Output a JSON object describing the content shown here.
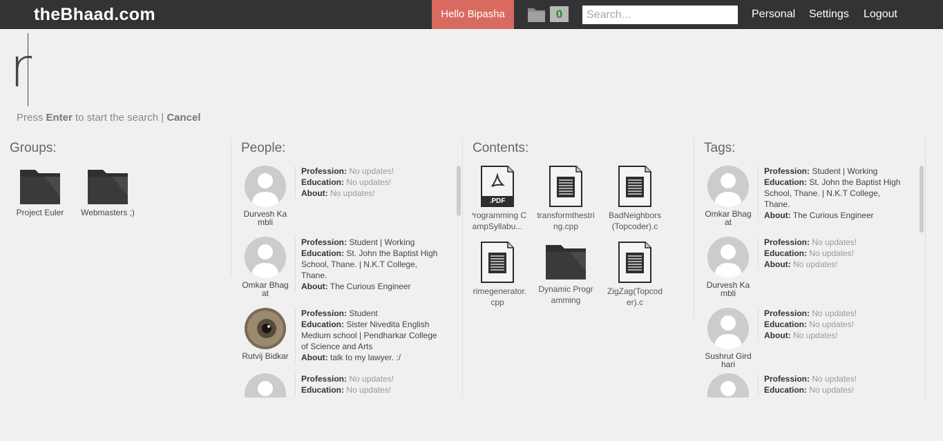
{
  "header": {
    "logo": "theBhaad.com",
    "greeting": "Hello Bipasha",
    "folder_count": "0",
    "search_placeholder": "Search...",
    "nav": [
      "Personal",
      "Settings",
      "Logout"
    ]
  },
  "search": {
    "query": "r",
    "hint_press": "Press ",
    "hint_enter": "Enter",
    "hint_rest": " to start the search | ",
    "hint_cancel": "Cancel"
  },
  "groups": {
    "title": "Groups:",
    "items": [
      "Project Euler",
      "Webmasters ;)"
    ]
  },
  "people": {
    "title": "People:",
    "items": [
      {
        "name": "Durvesh Kambli",
        "profession": "No updates!",
        "education": "No updates!",
        "about": "No updates!",
        "muted": true
      },
      {
        "name": "Omkar Bhagat",
        "profession": "Student | Working",
        "education": "St. John the Baptist High School, Thane. | N.K.T College, Thane.",
        "about": "The Curious Engineer",
        "muted": false
      },
      {
        "name": "Rutvij Bidkar",
        "profession": "Student",
        "education": "Sister Nivedita English Medium school | Pendharkar College of Science and Arts",
        "about": "talk to my lawyer. :/",
        "muted": false
      },
      {
        "name": "",
        "profession": "No updates!",
        "education": "No updates!",
        "about": "",
        "muted": true
      }
    ]
  },
  "contents": {
    "title": "Contents:",
    "items": [
      {
        "name": "Programming CampSyllabu...",
        "type": "pdf-icon",
        "pdf_label": ".PDF"
      },
      {
        "name": "transformthestring.cpp",
        "type": "document-icon"
      },
      {
        "name": "BadNeighbors(Topcoder).c",
        "type": "document-icon"
      },
      {
        "name": "primegenerator.cpp",
        "type": "document-icon"
      },
      {
        "name": "Dynamic Programming",
        "type": "folder-icon"
      },
      {
        "name": "ZigZag(Topcoder).c",
        "type": "document-icon"
      }
    ]
  },
  "tags": {
    "title": "Tags:",
    "items": [
      {
        "name": "Omkar Bhagat",
        "profession": "Student | Working",
        "education": "St. John the Baptist High School, Thane. | N.K.T College, Thane.",
        "about": "The Curious Engineer",
        "muted": false
      },
      {
        "name": "Durvesh Kambli",
        "profession": "No updates!",
        "education": "No updates!",
        "about": "No updates!",
        "muted": true
      },
      {
        "name": "Sushrut Girdhari",
        "profession": "No updates!",
        "education": "No updates!",
        "about": "No updates!",
        "muted": true
      },
      {
        "name": "",
        "profession": "No updates!",
        "education": "No updates!",
        "about": "",
        "muted": true
      }
    ]
  },
  "labels": {
    "profession": "Profession:",
    "education": "Education:",
    "about": "About:"
  },
  "colors": {
    "topbar": "#333333",
    "greeting_bg": "#d96a5f",
    "count_text": "#2e8b2e"
  }
}
